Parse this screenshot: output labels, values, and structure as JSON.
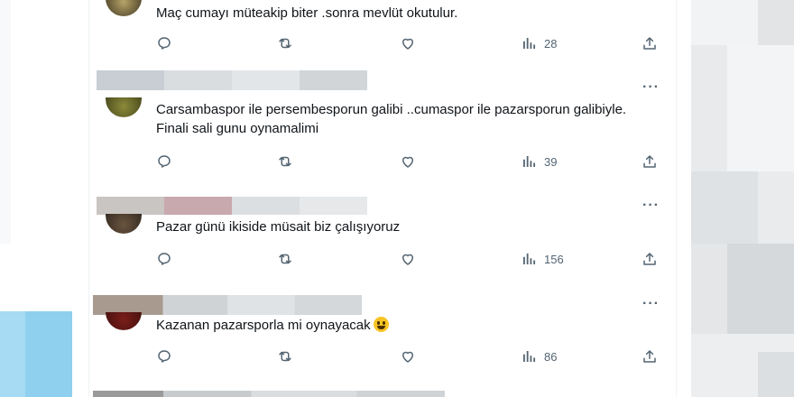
{
  "tweets": [
    {
      "text": "Maç cumayı müteakip biter .sonra mevlüt okutulur.",
      "views": "28",
      "more": "···"
    },
    {
      "text": "Carsambaspor ile persembesporun galibi ..cumaspor ile pazarsporun galibiyle. Finali sali gunu oynamalimi",
      "views": "39",
      "more": "···"
    },
    {
      "text": "Pazar günü ikiside müsait biz çalışıyoruz",
      "views": "156",
      "more": "···"
    },
    {
      "text": "Kazanan pazarsporla mi oynayacak",
      "views": "86",
      "more": "···",
      "emoji": "grinning-face"
    }
  ],
  "icons": [
    "reply-icon",
    "retweet-icon",
    "like-icon",
    "views-icon",
    "share-icon",
    "more-icon"
  ],
  "colors": {
    "icon": "#536471",
    "text": "#0f1419",
    "divider": "#e6ecf0",
    "bg_right": "#eef0f2"
  }
}
